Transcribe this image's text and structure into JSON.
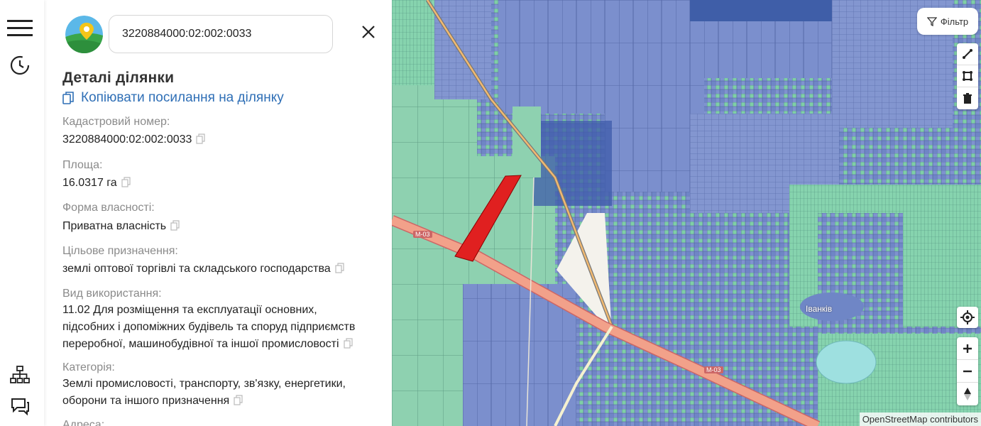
{
  "search": {
    "value": "3220884000:02:002:0033"
  },
  "details": {
    "title": "Деталі ділянки",
    "copy_link_label": "Копіювати посилання на ділянку",
    "fields": [
      {
        "label": "Кадастровий номер:",
        "value": "3220884000:02:002:0033"
      },
      {
        "label": "Площа:",
        "value": "16.0317 га"
      },
      {
        "label": "Форма власності:",
        "value": "Приватна власність"
      },
      {
        "label": "Цільове призначення:",
        "value": "землі оптової торгівлі та складського господарства"
      },
      {
        "label": "Вид використання:",
        "value_lines": [
          "11.02 Для розміщення та експлуатації основних,",
          "підсобних і допоміжних будівель та споруд підприємств",
          "переробної, машинобудівної та іншої промисловості"
        ]
      },
      {
        "label": "Категорія:",
        "value_lines": [
          "Землі промисловості, транспорту, зв'язку, енергетики,",
          "оборони та іншого призначення"
        ]
      },
      {
        "label": "Адреса:"
      }
    ]
  },
  "map": {
    "filter_label": "Фільтр",
    "attribution": "OpenStreetMap contributors",
    "place_label": "Іванків",
    "road_labels": [
      "М-03",
      "М-03"
    ],
    "colors": {
      "parcel_blue": "#7f94cf",
      "parcel_green": "#7fcfa6",
      "selected": "#e02020",
      "road": "#f2a18a"
    }
  }
}
